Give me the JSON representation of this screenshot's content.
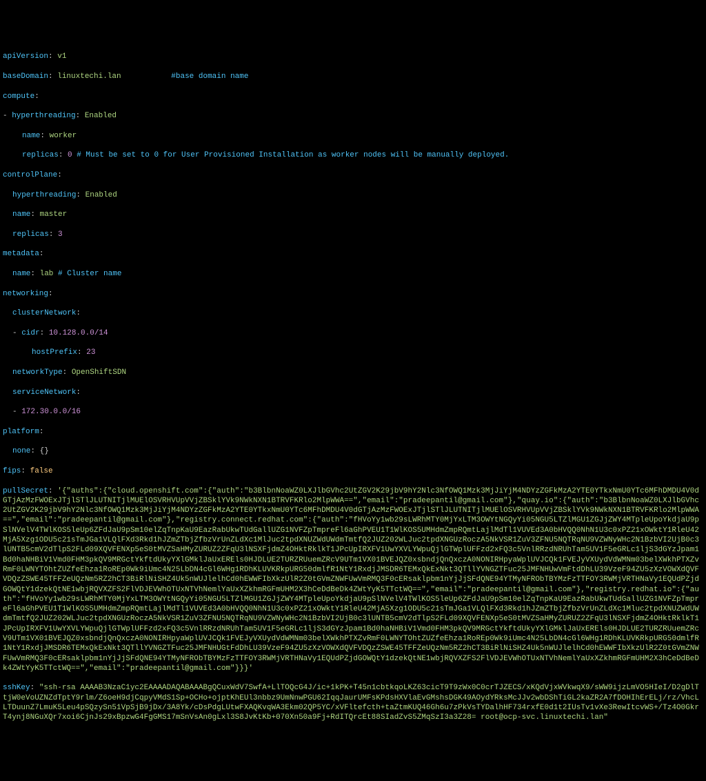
{
  "yaml": {
    "apiVersion_key": "apiVersion",
    "apiVersion_val": "v1",
    "baseDomain_key": "baseDomain",
    "baseDomain_val": "linuxtechi.lan",
    "baseDomain_comment": "#base domain name",
    "compute_key": "compute",
    "compute_hyperthreading_key": "hyperthreading",
    "compute_hyperthreading_val": "Enabled",
    "compute_name_key": "name",
    "compute_name_val": "worker",
    "compute_replicas_key": "replicas",
    "compute_replicas_val": "0",
    "compute_replicas_comment": "# Must be set to 0 for User Provisioned Installation as worker nodes will be manually deployed.",
    "controlPlane_key": "controlPlane",
    "controlPlane_hyperthreading_key": "hyperthreading",
    "controlPlane_hyperthreading_val": "Enabled",
    "controlPlane_name_key": "name",
    "controlPlane_name_val": "master",
    "controlPlane_replicas_key": "replicas",
    "controlPlane_replicas_val": "3",
    "metadata_key": "metadata",
    "metadata_name_key": "name",
    "metadata_name_val": "lab",
    "metadata_name_comment": "# Cluster name",
    "networking_key": "networking",
    "clusterNetwork_key": "clusterNetwork",
    "cidr_key": "cidr",
    "cidr_val": "10.128.0.0/14",
    "hostPrefix_key": "hostPrefix",
    "hostPrefix_val": "23",
    "networkType_key": "networkType",
    "networkType_val": "OpenShiftSDN",
    "serviceNetwork_key": "serviceNetwork",
    "serviceNetwork_val": "172.30.0.0/16",
    "platform_key": "platform",
    "platform_none_key": "none",
    "platform_none_val": "{}",
    "fips_key": "fips",
    "fips_val": "false",
    "pullSecret_key": "pullSecret",
    "pullSecret_val": "'{\"auths\":{\"cloud.openshift.com\":{\"auth\":\"b3BlbnNoaWZ0LXJlbGVhc2UtZGV2K29jbV9hY2Nlc3NfOWQ1Mzk3MjJiYjM4NDYzZGFkMzA2YTE0YTkxNmU0YTc6MFhDMDU4V0dGTjAzMzFWOExJTjlSTlJLUTNITjlMUElOSVRHVUpVVjZBSklYVk9NWkNXN1BTRVFKRlo2MlpWWA==\",\"email\":\"pradeepantil@gmail.com\"},\"quay.io\":{\"auth\":\"b3BlbnNoaWZ0LXJlbGVhc2UtZGV2K29jbV9hY2Nlc3NfOWQ1Mzk3MjJiYjM4NDYzZGFkMzA2YTE0YTkxNmU0YTc6MFhDMDU4V0dGTjAzMzFWOExJTjlSTlJLUTNITjlMUElOSVRHVUpVVjZBSklYVk9NWkNXN1BTRVFKRlo2MlpWWA==\",\"email\":\"pradeepantil@gmail.com\"},\"registry.connect.redhat.com\":{\"auth\":\"fHVoYy1wb29sLWRhMTY0MjYxLTM3OWYtNGQyYi05NGU5LTZlMGU1ZGJjZWY4MTpleUpoYkdjaU9pSlNVelV4TWlKOS5leUp6ZFdJaU9pSm10elZqTnpKaU9EazRabUkwTUdGallUZG1NVFZpTmpreFl6aGhPVEU1T1WlKOS5UMHdmZmpRQmtLajlMdTl1VUVEd3A0bHVQQ0NhN1U3c0xPZ21xOWktY1RleU42MjA5Xzg1ODU5c21sTmJGa1VLQlFXd3Rkd1hJZmZTbjZfbzVrUnZLdXc1MlJuc2tpdXNUZWdUWdmTmtfQ2JUZ202WLJuc2tpdXNGUzRoczA5NkVSR1ZuV3ZFNU5NQTRqNU9VZWNyWHc2N1BzbVI2UjB0c3lUNTB5cmV2dTlpS2FLd09XQVFENXp5eS0tMVZSaHMyZURUZ2ZFqU3lNSXFjdmZ4OHktRklkT1JPcUpIRXFV1UwYXVLYWpuQjlGTWplUFFzd2xFQ3c5VnlRRzdNRUhTam5UV1F5eGRLc1ljS3dGYzJpam1Bd0haNHBiV1Vmd0FHM3pkQV9MRGctYkftdUkyYXlGMklJaUxEREls0HJDLUE2TURZRUuemZRcV9UTm1VX01BVEJQZ0xsbndjQnQxczA0NONIRHpyaWplUVJCQk1FVEJyVXUydVdWMNm03belXWkhPTXZvRmF0LWNYTOhtZUZfeEhza1RoREp0Wk9iUmc4N25LbDN4cGl6WHg1RDhKLUVKRkpURG50dmlfR1NtY1RxdjJMSDR6TEMxQkExNkt3QTllYVNGZTFuc25JMFNHUwVmFtdDhLU39VzeF94ZU5zXzVOWXdQVFVDQzZSWE45TFFZeUQzNm5RZ2hCT3BiRlNiSHZ4Uk5nWUJlelhCd0hEWWFIbXkzUlR2Z0tGVmZNWFUwVmRMQ3F0cERsaklpbm1nYjJjSFdQNE94YTMyNFRObTBYMzFzTTFOY3RWMjVRTHNaVy1EQUdPZjdGOWQtY1dzekQtNE1wbjRQVXZFS2FlVDJEVWhOTUxNTVhNemlYaUxXZkhmRGFmUHM2X3hCeDdBeDk4ZWtYyK5TTctWQ==\",\"email\":\"pradeepantil@gmail.com\"},\"registry.redhat.io\":{\"auth\":\"fHVoYy1wb29sLWRhMTY0MjYxLTM3OWYtNGQyYi05NGU5LTZlMGU1ZGJjZWY4MTpleUpoYkdjaU9pSlNVelV4TWlKOS5leUp6ZFdJaU9pSm10elZqTnpKaU9EazRabUkwTUdGallUZG1NVFZpTmpreFl6aGhPVEU1T1WlKOS5UMHdmZmpRQmtLajlMdTl1VUVEd3A0bHVQQ0NhN1U3c0xPZ21xOWktY1RleU42MjA5Xzg1ODU5c21sTmJGa1VLQlFXd3Rkd1hJZmZTbjZfbzVrUnZLdXc1Mluc2tpdXNUZWdUWdmTmtfQ2JUZ202WLJuc2tpdXNGUzRoczA5NkVSR1ZuV3ZFNU5NQTRqNU9VZWNyWHc2N1BzbVI2UjB0c3lUNTB5cmV2dTlpS2FLd09XQVFENXp5eS0tMVZSaHMyZURUZ2ZFqU3lNSXFjdmZ4OHktRklkT1JPcUpIRXFV1UwYXVLYWpuQjlGTWplUFFzd2xFQ3c5VnlRRzdNRUhTam5UV1F5eGRLc1ljS3dGYzJpam1Bd0haNHBiV1Vmd0FHM3pkQV9MRGctYkftdUkyYXlGMklJaUxEREls0HJDLUE2TURZRUuemZRcV9UTm1VX01BVEJQZ0xsbndjQnQxczA0NONIRHpyaWplUVJCQk1FVEJyVXUydVdWMNm03belXWkhPTXZvRmF0LWNYTOhtZUZfeEhza1RoREp0Wk9iUmc4N25LbDN4cGl6WHg1RDhKLUVKRkpURG50dmlfR1NtY1RxdjJMSDR6TEMxQkExNkt3QTllYVNGZTFuc25JMFNHUGtFdDhLU39VzeF94ZU5zXzVOWXdQVFVDQzZSWE45TFFZeUQzNm5RZ2hCT3BiRlNiSHZ4Uk5nWUJlelhCd0hEWWFIbXkzUlR2Z0tGVmZNWFUwVmRMQ3F0cERsaklpbm1nYjJjSFdQNE94YTMyNFRObTBYMzFzTTFOY3RWMjVRTHNaVy1EQUdPZjdGOWQtY1dzekQtNE1wbjRQVXZFS2FlVDJEVWhOTUxNTVhNemlYaUxXZkhmRGFmUHM2X3hCeDdBeDk4ZWtYyK5TTctWQ==\",\"email\":\"pradeepantil@gmail.com\"}}}'",
    "sshKey_key": "sshKey",
    "sshKey_val": "\"ssh-rsa AAAAB3NzaC1yc2EAAAADAQABAAABgQCuxWdV7SwfA+LlTOQcG4J/ic+1kPK+T45n1cbtkqoLKZ63cicT9T9zWx0C0crTJZECS/xKQdVjxWVkwqX9/sWW9ijzLmVO5HIeI/D2gDlTtjW0eVoUZNZdTptY9rlm/Z6oeH9djCqpyVMdS1Sp+OCHo+ojptKhEUl3nbbz9UmNnwPGU62IqqJaurUMFsKPdsHXVlaEvGMshsDGK49AOydYRksMcJJv2wbDShTiGL2kaZR2A7fDOHIhErELj/rz/VhcLLTDuunZ7LmuK5Leu4pSQzySn51VpSjB9jDx/3A8Yk/cDsPdgLUtwFXAQKvqWA3Ekm02QP5YC/xVFltefcth+taZtmKUQ46Gh6u7zPkVsTYDalhHF734rxfE0d1t2IUsTv1vXe3RewItcvWS+/Tz4O0GkrT4ynj8NGuXQr7xoi6CjnJs29xBpzwG4FgGMS17mSnVsAn0gLxl3S8JvKtKb+070Xn50a9Fj+RdITQrcEt88SIadZvS5ZMqSzI3a3Z28= root@ocp-svc.linuxtechi.lan\""
  }
}
